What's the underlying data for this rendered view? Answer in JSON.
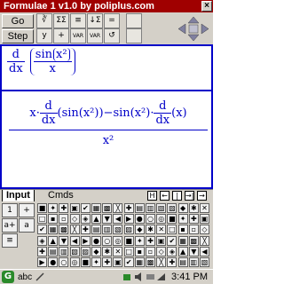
{
  "window": {
    "title": "Formulae 1 v1.0 by poliplus.com",
    "close": "×"
  },
  "toolbar": {
    "go": "Go",
    "step": "Step",
    "icons": [
      "∛",
      "ΣΣ",
      "≡",
      "↓Σ",
      "=",
      "y",
      "+",
      "VAR",
      "VAR",
      "↺"
    ]
  },
  "expression": {
    "step1": {
      "d": "d",
      "dx": "dx",
      "sin": "sin",
      "x2": "x²",
      "over": "x"
    },
    "step2": {
      "left": "x·",
      "d": "d",
      "dx": "dx",
      "term1": "(sin(x²))",
      "minus": "−sin(x²)·",
      "term2": "(x)",
      "denominator": "x²"
    }
  },
  "tabs": {
    "input": "Input",
    "cmds": "Cmds"
  },
  "nav_buttons": [
    "H",
    "←",
    "|←",
    "→|",
    "→"
  ],
  "keypad": {
    "left": [
      "1",
      "+",
      "a+",
      "a",
      "≡"
    ],
    "left2": [
      "▸",
      "▸",
      "▸",
      "▸"
    ]
  },
  "taskbar": {
    "start": "G",
    "input_method": "abc",
    "time": "3:41 PM"
  }
}
